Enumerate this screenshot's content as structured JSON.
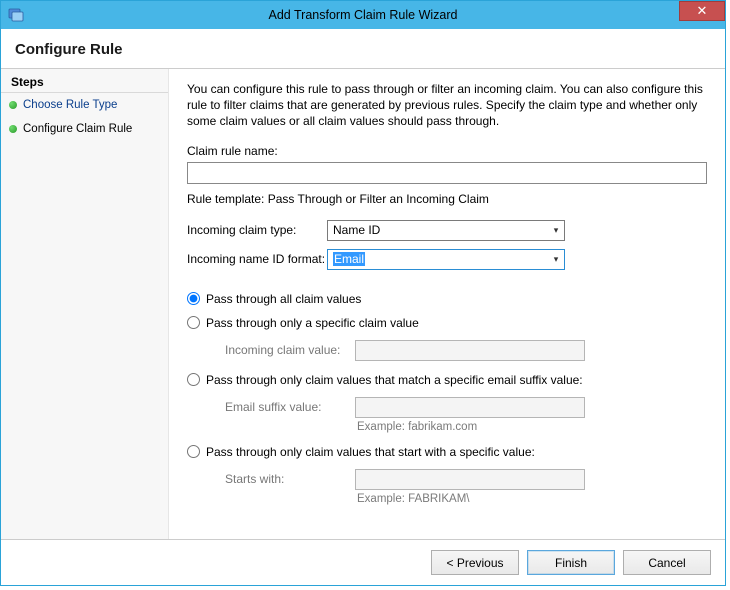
{
  "window": {
    "title": "Add Transform Claim Rule Wizard"
  },
  "header": "Configure Rule",
  "steps": {
    "heading": "Steps",
    "items": [
      {
        "label": "Choose Rule Type"
      },
      {
        "label": "Configure Claim Rule"
      }
    ]
  },
  "desc": "You can configure this rule to pass through or filter an incoming claim. You can also configure this rule to filter claims that are generated by previous rules. Specify the claim type and whether only some claim values or all claim values should pass through.",
  "ruleName": {
    "label": "Claim rule name:",
    "value": ""
  },
  "templateLine": "Rule template: Pass Through or Filter an Incoming Claim",
  "incomingType": {
    "label": "Incoming claim type:",
    "value": "Name ID"
  },
  "incomingFormat": {
    "label": "Incoming name ID format:",
    "value": "Email"
  },
  "options": {
    "all": "Pass through all claim values",
    "specific": "Pass through only a specific claim value",
    "specific_label": "Incoming claim value:",
    "suffix": "Pass through only claim values that match a specific email suffix value:",
    "suffix_label": "Email suffix value:",
    "suffix_example": "Example: fabrikam.com",
    "starts": "Pass through only claim values that start with a specific value:",
    "starts_label": "Starts with:",
    "starts_example": "Example: FABRIKAM\\"
  },
  "buttons": {
    "prev": "< Previous",
    "finish": "Finish",
    "cancel": "Cancel"
  }
}
